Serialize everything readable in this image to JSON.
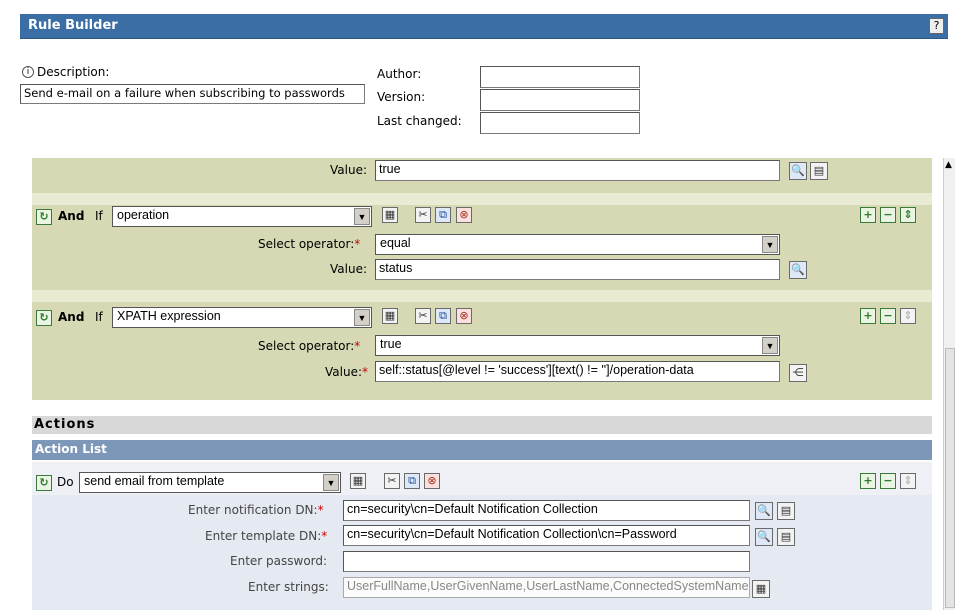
{
  "header": {
    "title": "Rule Builder",
    "help_icon": "?"
  },
  "meta": {
    "description_label": "Description:",
    "description_value": "Send e-mail on a failure when subscribing to passwords",
    "author_label": "Author:",
    "version_label": "Version:",
    "last_changed_label": "Last changed:",
    "author_value": "",
    "version_value": "",
    "last_changed_value": ""
  },
  "conditions": {
    "top_value_label": "Value:",
    "top_value": "true",
    "cond1": {
      "and_label": "And",
      "if_label": "If",
      "type": "operation",
      "operator_label": "Select operator:",
      "operator": "equal",
      "value_label": "Value:",
      "value": "status"
    },
    "cond2": {
      "and_label": "And",
      "if_label": "If",
      "type": "XPATH expression",
      "operator_label": "Select operator:",
      "operator": "true",
      "value_label": "Value:",
      "value": "self::status[@level != 'success'][text() != '']/operation-data"
    }
  },
  "actions": {
    "section_title": "Actions",
    "list_title": "Action List",
    "do_label": "Do",
    "action": "send email from template",
    "notification_label": "Enter notification DN:",
    "notification_value": "cn=security\\cn=Default Notification Collection",
    "template_label": "Enter template DN:",
    "template_value": "cn=security\\cn=Default Notification Collection\\cn=Password",
    "password_label": "Enter password:",
    "password_value": "",
    "strings_label": "Enter strings:",
    "strings_value": "UserFullName,UserGivenName,UserLastName,ConnectedSystemName"
  }
}
